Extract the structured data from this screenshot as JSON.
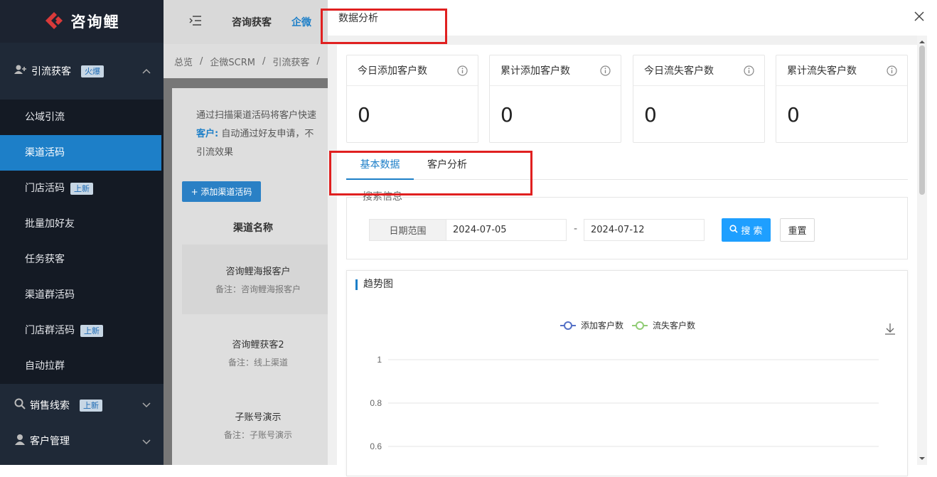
{
  "app": {
    "name": "咨询鲤"
  },
  "sidebar": {
    "group1": {
      "label": "引流获客",
      "badge": "火爆"
    },
    "sub_items": [
      {
        "label": "公域引流",
        "badge": ""
      },
      {
        "label": "渠道活码",
        "badge": ""
      },
      {
        "label": "门店活码",
        "badge": "上新"
      },
      {
        "label": "批量加好友",
        "badge": ""
      },
      {
        "label": "任务获客",
        "badge": ""
      },
      {
        "label": "渠道群活码",
        "badge": ""
      },
      {
        "label": "门店群活码",
        "badge": "上新"
      },
      {
        "label": "自动拉群",
        "badge": ""
      }
    ],
    "group2": {
      "label": "销售线索",
      "badge": "上新"
    },
    "group3": {
      "label": "客户管理"
    }
  },
  "topbar": {
    "tab1": "咨询获客",
    "tab2": "企微"
  },
  "breadcrumb": [
    "总览",
    "企微SCRM",
    "引流获客"
  ],
  "background": {
    "desc_line1": "通过扫描渠道活码将客户快速",
    "desc_label": "客户:",
    "desc_line2": "自动通过好友申请，不",
    "desc_line3": "引流效果",
    "add_button": "+ 添加渠道活码",
    "column_header": "渠道名称",
    "rows": [
      {
        "name": "咨询鲤海报客户",
        "note": "备注：咨询鲤海报客户"
      },
      {
        "name": "咨询鲤获客2",
        "note": "备注：线上渠道"
      },
      {
        "name": "子账号演示",
        "note": "备注：子账号演示"
      }
    ]
  },
  "drawer": {
    "title": "数据分析",
    "stats": [
      {
        "label": "今日添加客户数",
        "value": "0"
      },
      {
        "label": "累计添加客户数",
        "value": "0"
      },
      {
        "label": "今日流失客户数",
        "value": "0"
      },
      {
        "label": "累计流失客户数",
        "value": "0"
      }
    ],
    "tabs": [
      "基本数据",
      "客户分析"
    ],
    "search": {
      "legend": "搜索信息",
      "date_label": "日期范围",
      "start_date": "2024-07-05",
      "end_date": "2024-07-12",
      "separator": "-",
      "search_button": "搜 索",
      "reset_button": "重置"
    },
    "chart_title": "趋势图"
  },
  "chart_data": {
    "type": "line",
    "title": "趋势图",
    "series": [
      {
        "name": "添加客户数",
        "color": "#5470c6",
        "values": []
      },
      {
        "name": "流失客户数",
        "color": "#91cc75",
        "values": []
      }
    ],
    "y_ticks": [
      "1",
      "0.8",
      "0.6"
    ],
    "ylim": [
      0,
      1
    ],
    "legend_position": "top-center"
  },
  "colors": {
    "accent": "#1d7fc8",
    "search_button": "#1e9fff",
    "highlight": "#e02020"
  }
}
